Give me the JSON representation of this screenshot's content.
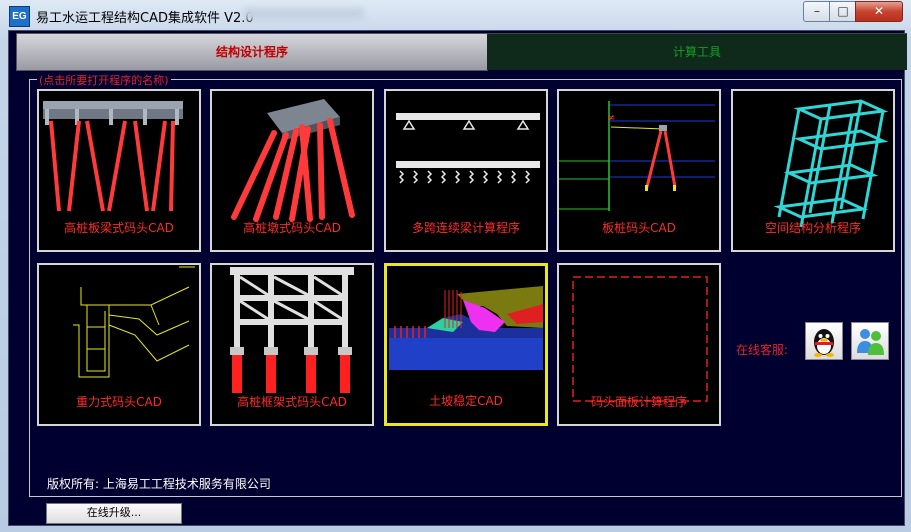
{
  "window": {
    "title": "易工水运工程结构CAD集成软件 V2.0",
    "icon_text": "EG",
    "minimize_glyph": "–",
    "maximize_glyph": "□",
    "close_glyph": "✕"
  },
  "tabs": [
    {
      "label": "结构设计程序",
      "active": true
    },
    {
      "label": "计算工具",
      "active": false
    }
  ],
  "group": {
    "label": "(点击所要打开程序的名称)"
  },
  "programs": [
    {
      "label": "高桩板梁式码头CAD",
      "icon": "pile-slab-wharf-icon"
    },
    {
      "label": "高桩墩式码头CAD",
      "icon": "pile-pier-wharf-icon"
    },
    {
      "label": "多跨连续梁计算程序",
      "icon": "continuous-beam-icon"
    },
    {
      "label": "板桩码头CAD",
      "icon": "sheet-pile-wharf-icon"
    },
    {
      "label": "空间结构分析程序",
      "icon": "space-frame-icon"
    },
    {
      "label": "重力式码头CAD",
      "icon": "gravity-wharf-icon"
    },
    {
      "label": "高桩框架式码头CAD",
      "icon": "pile-frame-wharf-icon"
    },
    {
      "label": "土坡稳定CAD",
      "icon": "slope-stability-icon",
      "selected": true
    },
    {
      "label": "码头面板计算程序",
      "icon": "wharf-panel-icon"
    }
  ],
  "support": {
    "label": "在线客服:",
    "buttons": [
      {
        "name": "qq-support-button",
        "icon": "qq-penguin-icon"
      },
      {
        "name": "msn-support-button",
        "icon": "msn-messenger-icon"
      }
    ]
  },
  "footer": {
    "copyright": "版权所有: 上海易工工程技术服务有限公司",
    "upgrade_label": "在线升级..."
  },
  "colors": {
    "background": "#000030",
    "label_red": "#ff2a2a",
    "pile_red": "#ff3030",
    "active_tab_text": "#c00000",
    "inactive_tab_text": "#11a020"
  }
}
